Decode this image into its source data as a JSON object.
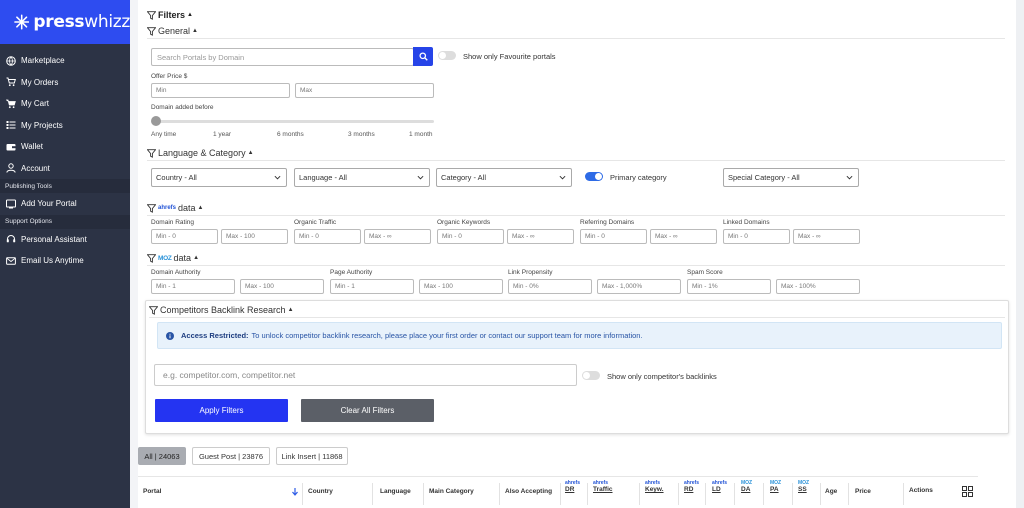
{
  "brand": {
    "name_bold": "press",
    "name_light": "whizz"
  },
  "sidebar": {
    "items": [
      {
        "label": "Marketplace",
        "icon": "globe-icon"
      },
      {
        "label": "My Orders",
        "icon": "cart-icon"
      },
      {
        "label": "My Cart",
        "icon": "cart-icon"
      },
      {
        "label": "My Projects",
        "icon": "list-icon"
      },
      {
        "label": "Wallet",
        "icon": "wallet-icon"
      },
      {
        "label": "Account",
        "icon": "user-icon"
      }
    ],
    "section_publishing": "Publishing Tools",
    "add_portal": "Add Your Portal",
    "section_support": "Support Options",
    "personal_assistant": "Personal Assistant",
    "email_us": "Email Us Anytime"
  },
  "filters": {
    "title": "Filters",
    "general": {
      "title": "General",
      "search_placeholder": "Search Portals by Domain",
      "favourite_label": "Show only Favourite portals",
      "offer_price_label": "Offer Price $",
      "min_placeholder": "Min",
      "max_placeholder": "Max",
      "domain_added_label": "Domain added before",
      "slider_ticks": [
        "Any time",
        "1 year",
        "6 months",
        "3 months",
        "1 month"
      ]
    },
    "language_category": {
      "title": "Language & Category",
      "country": "Country - All",
      "language": "Language - All",
      "category": "Category - All",
      "primary_label": "Primary category",
      "special": "Special Category - All"
    },
    "ahrefs": {
      "brand": "ahrefs",
      "suffix": "data",
      "labels": [
        "Domain Rating",
        "Organic Traffic",
        "Organic Keywords",
        "Referring Domains",
        "Linked Domains"
      ],
      "inputs": [
        [
          "Min - 0",
          "Max - 100"
        ],
        [
          "Min - 0",
          "Max - ∞"
        ],
        [
          "Min - 0",
          "Max - ∞"
        ],
        [
          "Min - 0",
          "Max - ∞"
        ],
        [
          "Min - 0",
          "Max - ∞"
        ]
      ]
    },
    "moz": {
      "brand": "MOZ",
      "suffix": "data",
      "labels": [
        "Domain Authority",
        "Page Authority",
        "Link Propensity",
        "Spam Score"
      ],
      "inputs": [
        [
          "Min - 1",
          "Max - 100"
        ],
        [
          "Min - 1",
          "Max - 100"
        ],
        [
          "Min - 0%",
          "Max - 1,000%"
        ],
        [
          "Min - 1%",
          "Max - 100%"
        ]
      ]
    },
    "competitors": {
      "title": "Competitors Backlink Research",
      "alert_strong": "Access Restricted:",
      "alert_text": "To unlock competitor backlink research, please place your first order or contact our support team for more information.",
      "input_placeholder": "e.g. competitor.com, competitor.net",
      "toggle_label": "Show only competitor's backlinks",
      "apply": "Apply Filters",
      "clear": "Clear All Filters"
    }
  },
  "tabs": [
    {
      "label": "All | 24063",
      "active": true
    },
    {
      "label": "Guest Post | 23876",
      "active": false
    },
    {
      "label": "Link Insert | 11868",
      "active": false
    }
  ],
  "table": {
    "headers": {
      "portal": "Portal",
      "country": "Country",
      "language": "Language",
      "main_category": "Main Category",
      "also_accepting": "Also Accepting",
      "dr": "DR",
      "traffic": "Traffic",
      "keyw": "Keyw.",
      "rd": "RD",
      "ld": "LD",
      "da": "DA",
      "pa": "PA",
      "ss": "SS",
      "age": "Age",
      "price": "Price",
      "actions": "Actions"
    },
    "brand_ahrefs": "ahrefs",
    "brand_moz": "MOZ"
  }
}
